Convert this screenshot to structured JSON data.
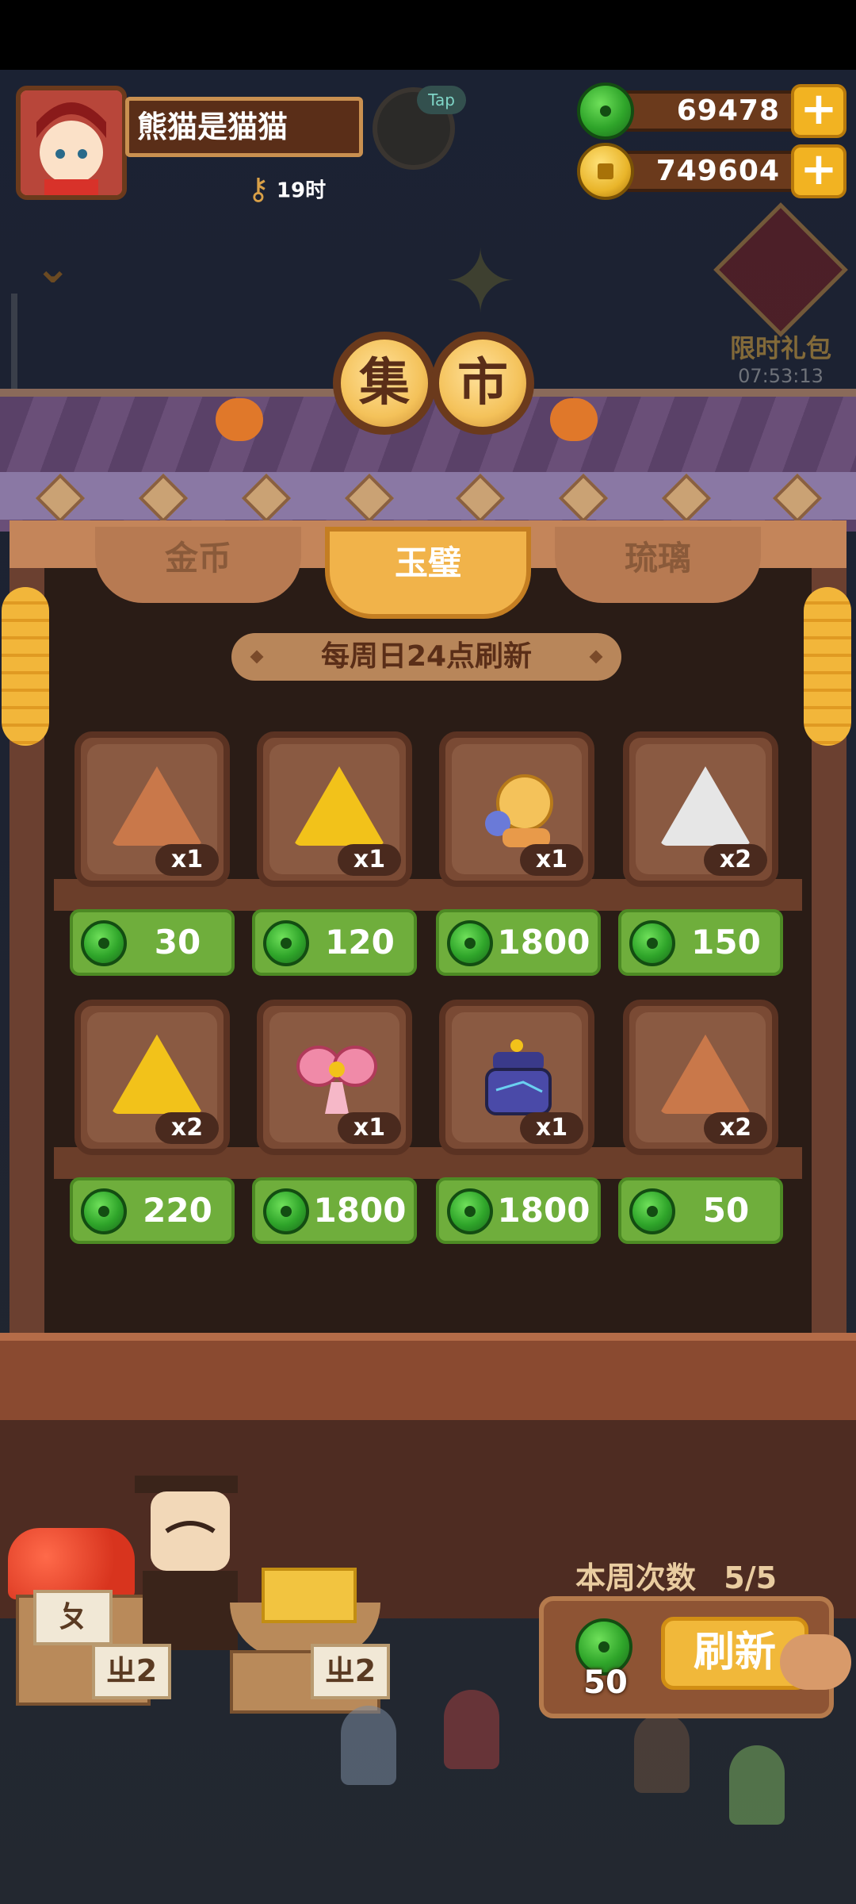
{
  "player": {
    "name": "熊猫是猫猫",
    "timer_label": "19时",
    "tap_label": "Tap"
  },
  "currency": {
    "jade": {
      "value": "69478",
      "icon": "jade-icon"
    },
    "coin": {
      "value": "749604",
      "icon": "coin-icon"
    },
    "plus_label": "+"
  },
  "gift": {
    "label": "限时礼包",
    "countdown": "07:53:13"
  },
  "market": {
    "title_chars": [
      "集",
      "市"
    ],
    "tabs": [
      {
        "label": "金币",
        "active": false
      },
      {
        "label": "玉璧",
        "active": true
      },
      {
        "label": "琉璃",
        "active": false
      }
    ],
    "refresh_notice": "每周日24点刷新",
    "items": [
      {
        "icon": "bronze-triangle-token-icon",
        "qty": "x1",
        "price": "30"
      },
      {
        "icon": "gold-triangle-token-icon",
        "qty": "x1",
        "price": "120"
      },
      {
        "icon": "cat-with-flowers-icon",
        "qty": "x1",
        "price": "1800"
      },
      {
        "icon": "silver-triangle-token-icon",
        "qty": "x2",
        "price": "150"
      },
      {
        "icon": "gold-antler-token-icon",
        "qty": "x2",
        "price": "220"
      },
      {
        "icon": "pink-butterfly-bow-icon",
        "qty": "x1",
        "price": "1800"
      },
      {
        "icon": "blue-lantern-pot-icon",
        "qty": "x1",
        "price": "1800"
      },
      {
        "icon": "bronze-glyph-token-icon",
        "qty": "x2",
        "price": "50"
      }
    ]
  },
  "weekly": {
    "label": "本周次数",
    "count": "5/5"
  },
  "refresh": {
    "cost": "50",
    "button_label": "刷新"
  },
  "stall_signs": [
    "ㄓ2",
    "ㄓ2",
    "ㄆ"
  ],
  "colors": {
    "jade": "#2fa52a",
    "coin": "#e9b52a",
    "price_bg": "#6fae3c",
    "active_tab": "#f1b34a"
  }
}
